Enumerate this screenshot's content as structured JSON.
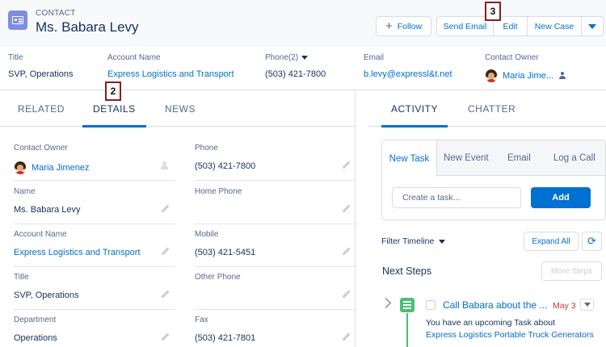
{
  "header": {
    "object_type": "CONTACT",
    "record_name": "Ms. Babara Levy",
    "buttons": {
      "follow": "Follow",
      "send_email": "Send Email",
      "edit": "Edit",
      "new_case": "New Case"
    }
  },
  "callouts": {
    "edit_marker": "3",
    "details_marker": "2"
  },
  "highlights": {
    "title_label": "Title",
    "title_value": "SVP, Operations",
    "account_label": "Account Name",
    "account_value": "Express Logistics and Transport",
    "phone_label": "Phone(2)",
    "phone_value": "(503) 421-7800",
    "email_label": "Email",
    "email_value": "b.levy@expressl&t.net",
    "owner_label": "Contact Owner",
    "owner_value": "Maria Jime..."
  },
  "left_tabs": {
    "related": "RELATED",
    "details": "DETAILS",
    "news": "NEWS"
  },
  "details": {
    "contact_owner": {
      "label": "Contact Owner",
      "value": "Maria Jimenez"
    },
    "phone": {
      "label": "Phone",
      "value": "(503) 421-7800"
    },
    "name": {
      "label": "Name",
      "value": "Ms. Babara Levy"
    },
    "home_phone": {
      "label": "Home Phone",
      "value": ""
    },
    "account_name": {
      "label": "Account Name",
      "value": "Express Logistics and Transport"
    },
    "mobile": {
      "label": "Mobile",
      "value": "(503) 421-5451"
    },
    "title": {
      "label": "Title",
      "value": "SVP, Operations"
    },
    "other_phone": {
      "label": "Other Phone",
      "value": ""
    },
    "department": {
      "label": "Department",
      "value": "Operations"
    },
    "fax": {
      "label": "Fax",
      "value": "(503) 421-7801"
    }
  },
  "right_tabs": {
    "activity": "ACTIVITY",
    "chatter": "CHATTER"
  },
  "publisher": {
    "tabs": {
      "new_task": "New Task",
      "new_event": "New Event",
      "email": "Email",
      "log_call": "Log a Call"
    },
    "task_placeholder": "Create a task...",
    "add_label": "Add"
  },
  "timeline": {
    "filter_label": "Filter Timeline",
    "expand_all": "Expand All",
    "next_steps": "Next Steps",
    "more_steps": "More Steps",
    "task": {
      "title": "Call Babara about the ...",
      "date": "May 3",
      "description": "You have an upcoming Task about",
      "related": "Express Logistics Portable Truck Generators"
    }
  },
  "icons": [
    "contact-card-icon",
    "plus-icon",
    "chevron-down-icon",
    "avatar",
    "change-owner-icon",
    "pencil-icon",
    "lock-icon",
    "refresh-icon",
    "chevron-right-icon",
    "task-icon",
    "checkbox"
  ],
  "colors": {
    "accent": "#0070d2",
    "contact_icon": "#7f8de1",
    "task_green": "#4bc076",
    "overdue_red": "#c23934"
  }
}
